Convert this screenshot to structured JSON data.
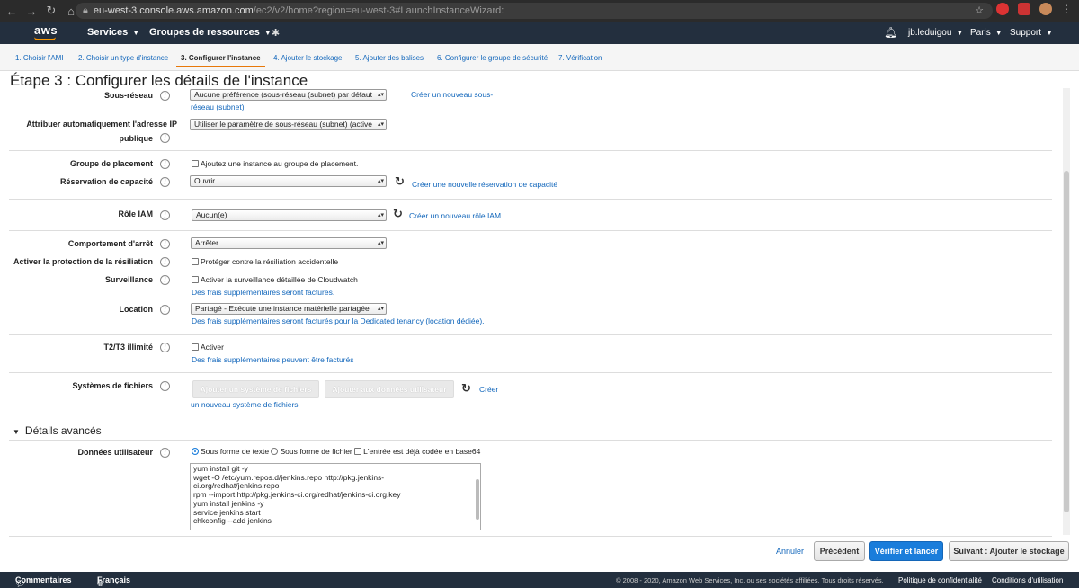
{
  "browser": {
    "url_host": "eu-west-3.console.aws.amazon.com",
    "url_path": "/ec2/v2/home?region=eu-west-3#LaunchInstanceWizard:"
  },
  "aws": {
    "logo": "aws",
    "services": "Services",
    "resource_groups": "Groupes de ressources",
    "user": "jb.leduigou",
    "region": "Paris",
    "support": "Support"
  },
  "wizard_tabs": [
    "1. Choisir l'AMI",
    "2. Choisir un type d'instance",
    "3. Configurer l'instance",
    "4. Ajouter le stockage",
    "5. Ajouter des balises",
    "6. Configurer le groupe de sécurité",
    "7. Vérification"
  ],
  "page_title": "Étape 3 : Configurer les détails de l'instance",
  "form": {
    "subnet": {
      "label": "Sous-réseau",
      "value": "Aucune préférence (sous-réseau (subnet) par défaut",
      "link_1": "Créer un nouveau sous-",
      "link_2": "réseau (subnet)"
    },
    "public_ip": {
      "label_1": "Attribuer automatiquement l'adresse IP",
      "label_2": "publique",
      "value": "Utiliser le paramètre de sous-réseau (subnet) (active"
    },
    "placement": {
      "label": "Groupe de placement",
      "checkbox": "Ajoutez une instance au groupe de placement."
    },
    "capacity": {
      "label": "Réservation de capacité",
      "value": "Ouvrir",
      "link": "Créer une nouvelle réservation de capacité"
    },
    "iam": {
      "label": "Rôle IAM",
      "value": "Aucun(e)",
      "link": "Créer un nouveau rôle IAM"
    },
    "shutdown": {
      "label": "Comportement d'arrêt",
      "value": "Arrêter"
    },
    "termination": {
      "label": "Activer la protection de la résiliation",
      "checkbox": "Protéger contre la résiliation accidentelle"
    },
    "monitoring": {
      "label": "Surveillance",
      "checkbox": "Activer la surveillance détaillée de Cloudwatch",
      "note": "Des frais supplémentaires seront facturés."
    },
    "tenancy": {
      "label": "Location",
      "value": "Partagé - Exécute une instance matérielle partagée",
      "note": "Des frais supplémentaires seront facturés pour la Dedicated tenancy (location dédiée)."
    },
    "t2t3": {
      "label": "T2/T3 illimité",
      "checkbox": "Activer",
      "note": "Des frais supplémentaires peuvent être facturés"
    },
    "filesystems": {
      "label": "Systèmes de fichiers",
      "add_fs_button": "Ajouter un système de fichiers",
      "add_userdata_button": "Ajouter aux données utilisateur",
      "link_1": "Créer",
      "link_2": "un nouveau système de fichiers"
    }
  },
  "advanced": {
    "title": "Détails avancés",
    "userdata_label": "Données utilisateur",
    "opt_text": "Sous forme de texte",
    "opt_file": "Sous forme de fichier",
    "opt_b64": "L'entrée est déjà codée en base64",
    "script_lines": [
      "yum install git -y",
      "wget -O /etc/yum.repos.d/jenkins.repo http://pkg.jenkins-",
      "ci.org/redhat/jenkins.repo",
      "rpm --import http://pkg.jenkins-ci.org/redhat/jenkins-ci.org.key",
      "yum install jenkins -y",
      "service jenkins start",
      "chkconfig --add jenkins"
    ]
  },
  "buttons": {
    "cancel": "Annuler",
    "previous": "Précédent",
    "review": "Vérifier et lancer",
    "next": "Suivant : Ajouter le stockage"
  },
  "footer": {
    "feedback": "Commentaires",
    "language": "Français",
    "copyright": "© 2008 - 2020, Amazon Web Services, Inc. ou ses sociétés affiliées. Tous droits réservés.",
    "privacy": "Politique de confidentialité",
    "terms": "Conditions d'utilisation"
  }
}
